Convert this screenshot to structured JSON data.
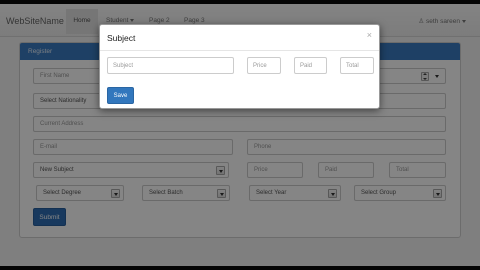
{
  "navbar": {
    "brand": "WebSiteName",
    "items": [
      {
        "label": "Home"
      },
      {
        "label": "Student"
      },
      {
        "label": "Page 2"
      },
      {
        "label": "Page 3"
      }
    ],
    "user": "seth sareen"
  },
  "form": {
    "heading": "Register",
    "first_name_placeholder": "First Name",
    "nationality": "Select Nationality",
    "address_placeholder": "Current Address",
    "email_placeholder": "E-mail",
    "phone_placeholder": "Phone",
    "subject": "New Subject",
    "price_placeholder": "Price",
    "paid_placeholder": "Paid",
    "total_placeholder": "Total",
    "degree": "Select Degree",
    "batch": "Select Batch",
    "year": "Select Year",
    "group": "Select Group",
    "submit_label": "Submit"
  },
  "modal": {
    "title": "Subject",
    "close_symbol": "×",
    "subject_placeholder": "Subject",
    "price_placeholder": "Price",
    "paid_placeholder": "Paid",
    "total_placeholder": "Total",
    "save_label": "Save"
  },
  "colors": {
    "panel_heading": "#3b7cc2",
    "primary_button": "#2f6eb5",
    "backdrop": "rgba(0,0,0,0.48)"
  }
}
